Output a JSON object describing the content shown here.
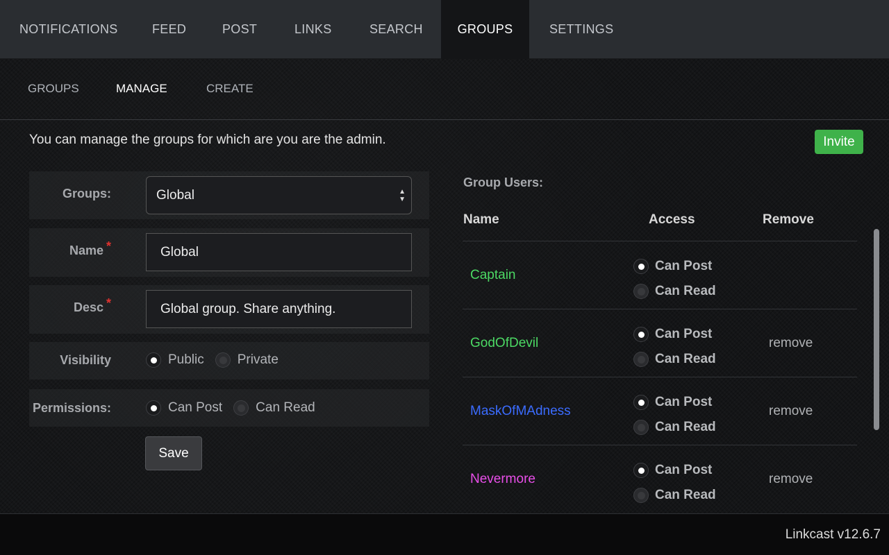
{
  "topnav": {
    "tabs": [
      {
        "label": "NOTIFICATIONS"
      },
      {
        "label": "FEED"
      },
      {
        "label": "POST"
      },
      {
        "label": "LINKS"
      },
      {
        "label": "SEARCH"
      },
      {
        "label": "GROUPS",
        "active": true
      },
      {
        "label": "SETTINGS"
      }
    ]
  },
  "subnav": {
    "tabs": [
      {
        "label": "GROUPS"
      },
      {
        "label": "MANAGE",
        "active": true
      },
      {
        "label": "CREATE"
      }
    ]
  },
  "intro_text": "You can manage the groups for which are you are the admin.",
  "invite_label": "Invite",
  "form": {
    "groups_label": "Groups:",
    "groups_selected": "Global",
    "name_label": "Name",
    "name_value": "Global",
    "desc_label": "Desc",
    "desc_value": "Global group. Share anything.",
    "required_mark": "*",
    "visibility_label": "Visibility",
    "visibility_options": [
      "Public",
      "Private"
    ],
    "visibility_selected": "Public",
    "permissions_label": "Permissions:",
    "permissions_options": [
      "Can Post",
      "Can Read"
    ],
    "permissions_selected": "Can Post",
    "save_label": "Save"
  },
  "group_users": {
    "title": "Group Users:",
    "columns": {
      "name": "Name",
      "access": "Access",
      "remove": "Remove"
    },
    "access_options": [
      "Can Post",
      "Can Read"
    ],
    "users": [
      {
        "name": "Captain",
        "color": "#4cd964",
        "access": "Can Post",
        "remove": ""
      },
      {
        "name": "GodOfDevil",
        "color": "#4cd964",
        "access": "Can Post",
        "remove": "remove"
      },
      {
        "name": "MaskOfMAdness",
        "color": "#3b6cff",
        "access": "Can Post",
        "remove": "remove"
      },
      {
        "name": "Nevermore",
        "color": "#e84ee8",
        "access": "Can Post",
        "remove": "remove"
      }
    ]
  },
  "footer": {
    "version": "Linkcast v12.6.7"
  }
}
